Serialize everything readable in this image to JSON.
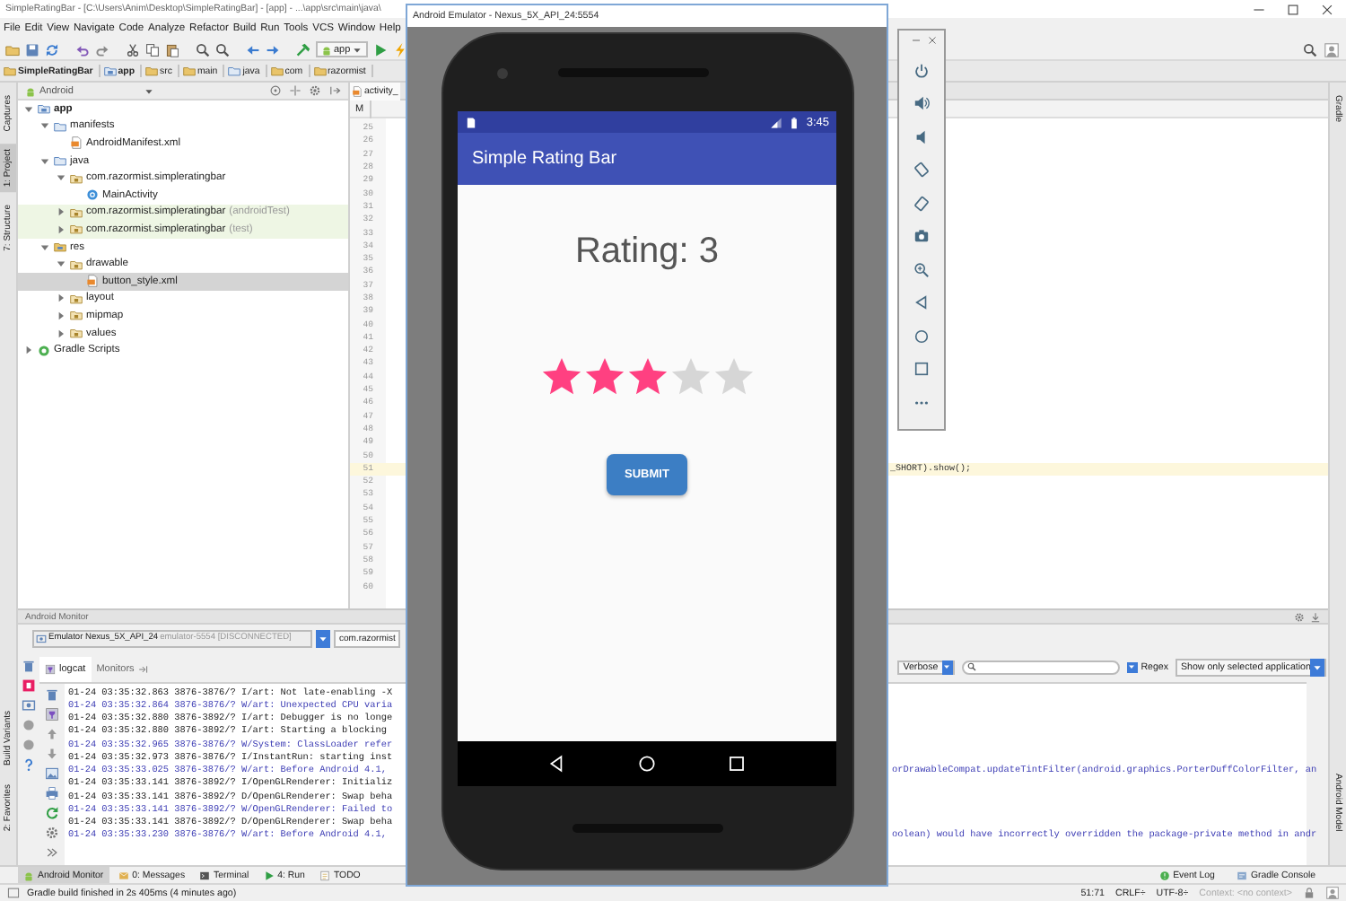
{
  "ide_title": "SimpleRatingBar - [C:\\Users\\Anim\\Desktop\\SimpleRatingBar] - [app] - ...\\app\\src\\main\\java\\",
  "menu": [
    "File",
    "Edit",
    "View",
    "Navigate",
    "Code",
    "Analyze",
    "Refactor",
    "Build",
    "Run",
    "Tools",
    "VCS",
    "Window",
    "Help"
  ],
  "toolbar": {
    "run_config": "app"
  },
  "breadcrumb": [
    {
      "label": "SimpleRatingBar",
      "kind": "project"
    },
    {
      "label": "app",
      "kind": "module"
    },
    {
      "label": "src",
      "kind": "folder"
    },
    {
      "label": "main",
      "kind": "folder"
    },
    {
      "label": "java",
      "kind": "source"
    },
    {
      "label": "com",
      "kind": "folder"
    },
    {
      "label": "razormist",
      "kind": "folder"
    }
  ],
  "left_tool_tabs": [
    {
      "label": "Captures",
      "selected": false
    },
    {
      "label": "1: Project",
      "selected": true
    },
    {
      "label": "7: Structure",
      "selected": false
    }
  ],
  "left_tool_tabs_bottom": [
    {
      "label": "Build Variants",
      "selected": false
    },
    {
      "label": "2: Favorites",
      "selected": false
    }
  ],
  "right_tool_tabs": [
    {
      "label": "Gradle",
      "selected": false
    }
  ],
  "right_tool_tabs_bottom": [
    {
      "label": "Android Model",
      "selected": false
    }
  ],
  "project": {
    "view": "Android",
    "tree": [
      {
        "label": "app",
        "kind": "module",
        "expanded": true,
        "selected": false,
        "highlighted": false,
        "children": [
          {
            "label": "manifests",
            "kind": "folder",
            "expanded": true,
            "selected": false,
            "highlighted": false,
            "children": [
              {
                "label": "AndroidManifest.xml",
                "kind": "manifest",
                "selected": false,
                "highlighted": false
              }
            ]
          },
          {
            "label": "java",
            "kind": "folder",
            "expanded": true,
            "selected": false,
            "highlighted": false,
            "children": [
              {
                "label": "com.razormist.simpleratingbar",
                "kind": "package",
                "expanded": true,
                "selected": false,
                "highlighted": false,
                "children": [
                  {
                    "label": "MainActivity",
                    "kind": "class",
                    "selected": false,
                    "highlighted": false
                  }
                ]
              },
              {
                "label": "com.razormist.simpleratingbar",
                "suffix": "(androidTest)",
                "kind": "package",
                "expanded": false,
                "selected": false,
                "highlighted": true
              },
              {
                "label": "com.razormist.simpleratingbar",
                "suffix": "(test)",
                "kind": "package",
                "expanded": false,
                "selected": false,
                "highlighted": true
              }
            ]
          },
          {
            "label": "res",
            "kind": "res",
            "expanded": true,
            "selected": false,
            "highlighted": false,
            "children": [
              {
                "label": "drawable",
                "kind": "package",
                "expanded": true,
                "selected": false,
                "highlighted": false,
                "children": [
                  {
                    "label": "button_style.xml",
                    "kind": "xml",
                    "selected": true,
                    "highlighted": false
                  }
                ]
              },
              {
                "label": "layout",
                "kind": "package",
                "expanded": false,
                "selected": false,
                "highlighted": false
              },
              {
                "label": "mipmap",
                "kind": "package",
                "expanded": false,
                "selected": false,
                "highlighted": false
              },
              {
                "label": "values",
                "kind": "package",
                "expanded": false,
                "selected": false,
                "highlighted": false
              }
            ]
          }
        ]
      },
      {
        "label": "Gradle Scripts",
        "kind": "gradle",
        "expanded": false,
        "selected": false,
        "highlighted": false
      }
    ]
  },
  "editor": {
    "tab": "activity_",
    "subtab": "M",
    "lines": [
      {
        "number": "25",
        "current": false
      },
      {
        "number": "26",
        "current": false
      },
      {
        "number": "27",
        "current": false
      },
      {
        "number": "28",
        "current": false
      },
      {
        "number": "29",
        "current": false
      },
      {
        "number": "30",
        "current": false
      },
      {
        "number": "31",
        "current": false
      },
      {
        "number": "32",
        "current": false
      },
      {
        "number": "33",
        "current": false
      },
      {
        "number": "34",
        "current": false
      },
      {
        "number": "35",
        "current": false
      },
      {
        "number": "36",
        "current": false
      },
      {
        "number": "37",
        "current": false
      },
      {
        "number": "38",
        "current": false
      },
      {
        "number": "39",
        "current": false
      },
      {
        "number": "40",
        "current": false
      },
      {
        "number": "41",
        "current": false
      },
      {
        "number": "42",
        "current": false
      },
      {
        "number": "43",
        "current": false
      },
      {
        "number": "44",
        "current": false
      },
      {
        "number": "45",
        "current": false
      },
      {
        "number": "46",
        "current": false
      },
      {
        "number": "47",
        "current": false
      },
      {
        "number": "48",
        "current": false
      },
      {
        "number": "49",
        "current": false
      },
      {
        "number": "50",
        "current": false
      },
      {
        "number": "51",
        "current": true,
        "code": "_SHORT).show();"
      },
      {
        "number": "52",
        "current": false
      },
      {
        "number": "53",
        "current": false
      },
      {
        "number": "54",
        "current": false
      },
      {
        "number": "55",
        "current": false
      },
      {
        "number": "56",
        "current": false
      },
      {
        "number": "57",
        "current": false
      },
      {
        "number": "58",
        "current": false
      },
      {
        "number": "59",
        "current": false
      },
      {
        "number": "60",
        "current": false
      }
    ]
  },
  "monitor": {
    "title": "Android Monitor",
    "device": "Emulator Nexus_5X_API_24",
    "device_detail": "emulator-5554 [DISCONNECTED]",
    "app": "com.razormist",
    "tabs": [
      {
        "label": "logcat",
        "selected": true
      },
      {
        "label": "Monitors",
        "selected": false
      }
    ],
    "log_level": "Verbose",
    "regex": {
      "label": "Regex",
      "checked": true
    },
    "filter": "Show only selected application",
    "lines": [
      {
        "color": "#222222",
        "text": "01-24 03:35:32.863 3876-3876/? I/art: Not late-enabling -X"
      },
      {
        "color": "#3c3cb4",
        "text": "01-24 03:35:32.864 3876-3876/? W/art: Unexpected CPU varia"
      },
      {
        "color": "#222222",
        "text": "01-24 03:35:32.880 3876-3892/? I/art: Debugger is no longe"
      },
      {
        "color": "#222222",
        "text": "01-24 03:35:32.880 3876-3892/? I/art: Starting a blocking"
      },
      {
        "color": "#3c3cb4",
        "text": "01-24 03:35:32.965 3876-3876/? W/System: ClassLoader refer"
      },
      {
        "color": "#222222",
        "text": "01-24 03:35:32.973 3876-3876/? I/InstantRun: starting inst"
      },
      {
        "color": "#3c3cb4",
        "text": "01-24 03:35:33.025 3876-3876/? W/art: Before Android 4.1,",
        "tail": "orDrawableCompat.updateTintFilter(android.graphics.PorterDuffColorFilter, an"
      },
      {
        "color": "#222222",
        "text": "01-24 03:35:33.141 3876-3892/? I/OpenGLRenderer: Initializ"
      },
      {
        "color": "#222222",
        "text": "01-24 03:35:33.141 3876-3892/? D/OpenGLRenderer: Swap beha"
      },
      {
        "color": "#3c3cb4",
        "text": "01-24 03:35:33.141 3876-3892/? W/OpenGLRenderer: Failed to"
      },
      {
        "color": "#222222",
        "text": "01-24 03:35:33.141 3876-3892/? D/OpenGLRenderer: Swap beha"
      },
      {
        "color": "#3c3cb4",
        "text": "01-24 03:35:33.230 3876-3876/? W/art: Before Android 4.1,",
        "tail": "oolean) would have incorrectly overridden the package-private method in andr"
      }
    ]
  },
  "bottom_tools": [
    {
      "label": "Android Monitor",
      "kind": "android",
      "selected": true
    },
    {
      "label": "0: Messages",
      "kind": "messages",
      "selected": false
    },
    {
      "label": "Terminal",
      "kind": "terminal",
      "selected": false
    },
    {
      "label": "4: Run",
      "kind": "run",
      "selected": false
    },
    {
      "label": "TODO",
      "kind": "todo",
      "selected": false
    }
  ],
  "bottom_tools_right": [
    {
      "label": "Event Log",
      "kind": "event"
    },
    {
      "label": "Gradle Console",
      "kind": "console"
    }
  ],
  "status": {
    "message": "Gradle build finished in 2s 405ms (4 minutes ago)",
    "position": "51:71",
    "line_separator": "CRLF÷",
    "encoding": "UTF-8÷",
    "context": "Context: <no context>"
  },
  "emulator": {
    "title": "Android Emulator - Nexus_5X_API_24:5554",
    "time": "3:45",
    "app_title": "Simple Rating Bar",
    "rating_text": "Rating: 3",
    "stars": 3,
    "button": "SUBMIT"
  }
}
